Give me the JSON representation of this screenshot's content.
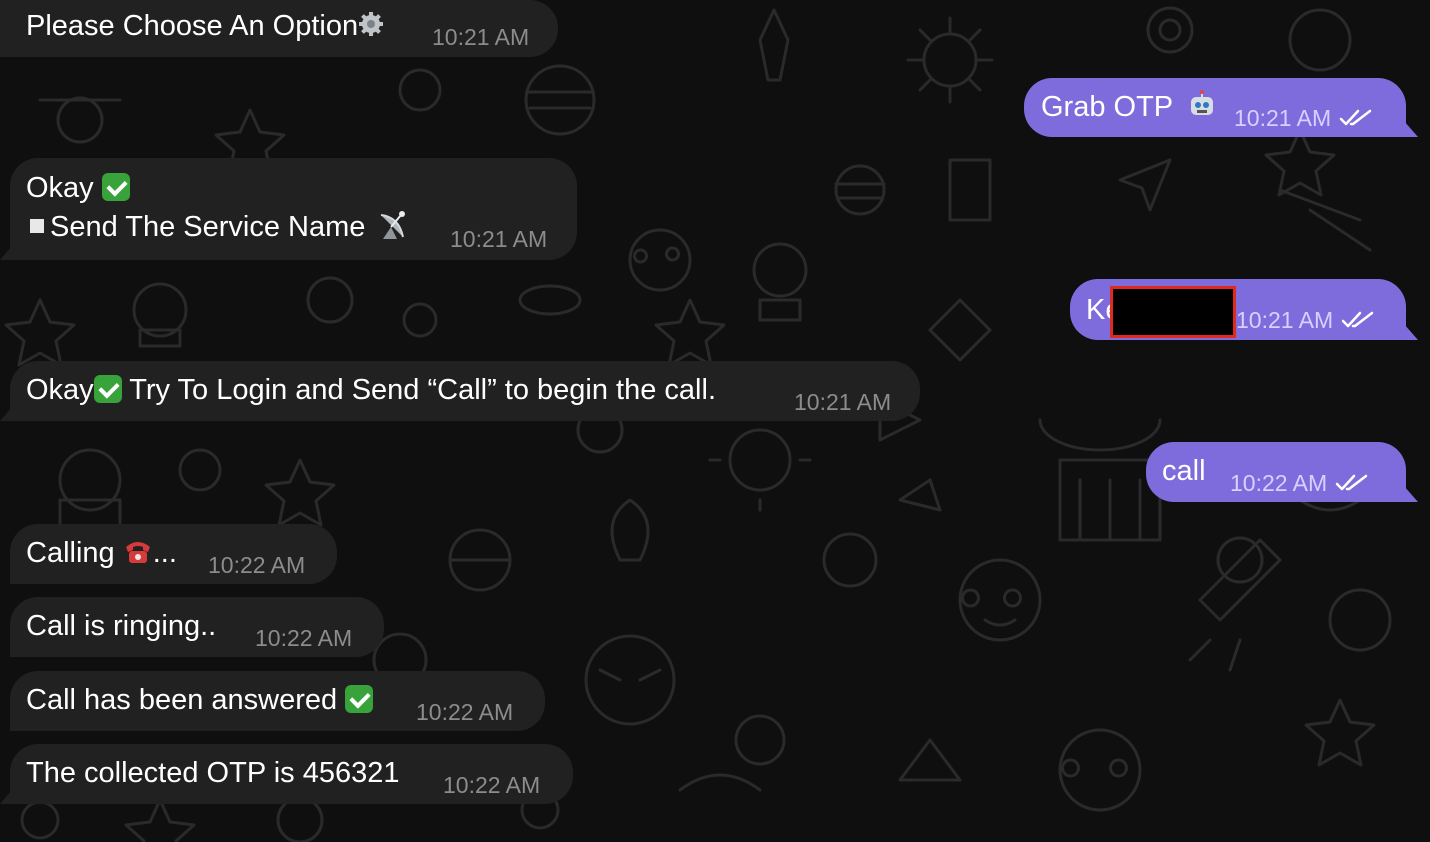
{
  "chat": {
    "messages": [
      {
        "direction": "incoming",
        "text": "Please Choose An Option",
        "icon": "gear-icon",
        "time": "10:21 AM"
      },
      {
        "direction": "outgoing",
        "text": "Grab OTP",
        "icon": "robot-icon",
        "time": "10:21 AM",
        "status": "read"
      },
      {
        "direction": "incoming",
        "line1": "Okay",
        "line1_icon": "check-mark-button-icon",
        "line2": "Send The Service Name",
        "line2_icon": "satellite-antenna-icon",
        "time": "10:21 AM"
      },
      {
        "direction": "outgoing",
        "text": "Ke",
        "redacted": true,
        "time": "10:21 AM",
        "status": "read"
      },
      {
        "direction": "incoming",
        "text_before": "Okay",
        "icon": "check-mark-button-icon",
        "text_after": " Try To Login and Send “Call” to begin the call.",
        "time": "10:21 AM"
      },
      {
        "direction": "outgoing",
        "text": "call",
        "time": "10:22 AM",
        "status": "read"
      },
      {
        "direction": "incoming",
        "text_before": "Calling ",
        "icon": "telephone-icon",
        "text_after": "...",
        "time": "10:22 AM"
      },
      {
        "direction": "incoming",
        "text": "Call is ringing..",
        "time": "10:22 AM"
      },
      {
        "direction": "incoming",
        "text": "Call has been answered ",
        "icon": "check-mark-button-icon",
        "time": "10:22 AM"
      },
      {
        "direction": "incoming",
        "text": "The collected OTP is 456321",
        "time": "10:22 AM"
      }
    ]
  },
  "colors": {
    "background": "#0f0f0f",
    "incoming_bubble": "#212121",
    "outgoing_bubble": "#7f6cdc",
    "redaction_border": "#e0291f",
    "check_emoji": "#37a33a"
  }
}
